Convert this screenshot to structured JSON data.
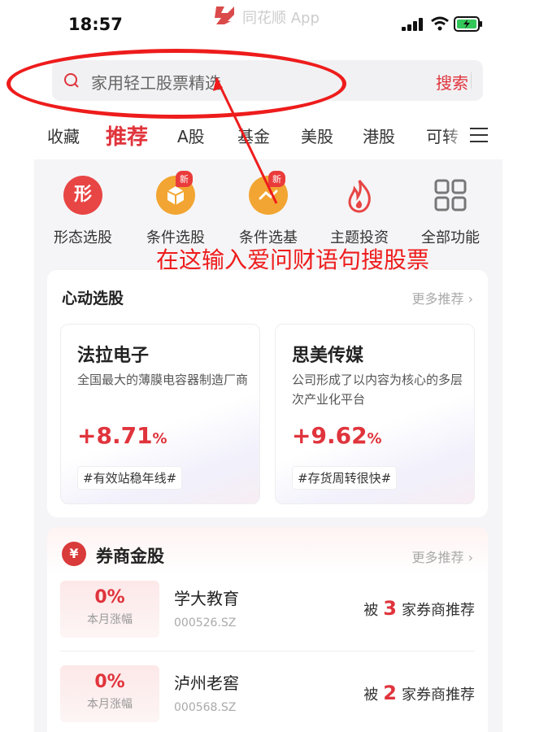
{
  "status": {
    "time": "18:57",
    "app_name": "同花顺 App"
  },
  "search": {
    "placeholder": "家用轻工股票精选",
    "button": "搜索"
  },
  "tabs": [
    {
      "label": "收藏"
    },
    {
      "label": "推荐",
      "active": true
    },
    {
      "label": "A股"
    },
    {
      "label": "基金"
    },
    {
      "label": "美股"
    },
    {
      "label": "港股"
    },
    {
      "label": "可转"
    }
  ],
  "functions": [
    {
      "label": "形态选股",
      "icon": "xing-icon",
      "icon_text": "形",
      "color": "#e84545"
    },
    {
      "label": "条件选股",
      "icon": "cube-icon",
      "badge": "新",
      "color": "#f2a532"
    },
    {
      "label": "条件选基",
      "icon": "fund-icon",
      "badge": "新",
      "color": "#f2a532"
    },
    {
      "label": "主题投资",
      "icon": "flame-icon",
      "color": "#e84545"
    },
    {
      "label": "全部功能",
      "icon": "grid-icon",
      "color": "#777777"
    }
  ],
  "annotation": "在这输入爱问财语句搜股票",
  "heart_picks": {
    "title": "心动选股",
    "more": "更多推荐",
    "items": [
      {
        "name": "法拉电子",
        "desc": "全国最大的薄膜电容器制造厂商",
        "change": "+8.71",
        "unit": "%",
        "tag": "#有效站稳年线#"
      },
      {
        "name": "思美传媒",
        "desc": "公司形成了以内容为核心的多层次产业化平台",
        "change": "+9.62",
        "unit": "%",
        "tag": "#存货周转很快#"
      }
    ]
  },
  "broker_picks": {
    "icon_text": "¥",
    "title": "券商金股",
    "more": "更多推荐",
    "items": [
      {
        "pct": "0%",
        "pct_label": "本月涨幅",
        "name": "学大教育",
        "code": "000526.SZ",
        "rec_prefix": "被",
        "rec_count": "3",
        "rec_suffix": "家券商推荐"
      },
      {
        "pct": "0%",
        "pct_label": "本月涨幅",
        "name": "泸州老窖",
        "code": "000568.SZ",
        "rec_prefix": "被",
        "rec_count": "2",
        "rec_suffix": "家券商推荐"
      }
    ]
  },
  "colors": {
    "accent": "#e0343c",
    "annotation": "#ee1c1c"
  }
}
